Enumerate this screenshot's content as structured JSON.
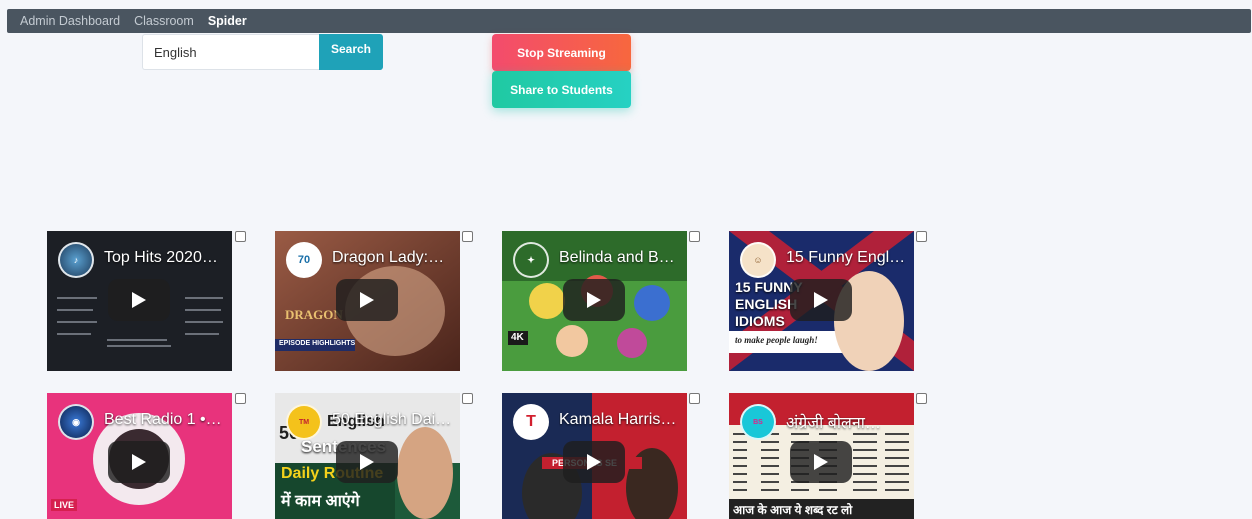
{
  "nav": {
    "items": [
      {
        "label": "Admin Dashboard"
      },
      {
        "label": "Classroom"
      },
      {
        "label": "Spider"
      }
    ]
  },
  "search": {
    "value": "English",
    "button_label": "Search"
  },
  "actions": {
    "stop_label": "Stop Streaming",
    "share_label": "Share to Students"
  },
  "videos": [
    {
      "title": "Top Hits 2020…",
      "icon": "music-channel-icon",
      "colors": {
        "bg": "#1c1f25",
        "accent": "#2a6f9e"
      }
    },
    {
      "title": "Dragon Lady:…",
      "icon": "channel-70-logo-icon",
      "colors": {
        "bg": "#6b3b2e",
        "accent": "#e5c4a0"
      }
    },
    {
      "title": "Belinda and B…",
      "icon": "fairy-tale-channel-icon",
      "colors": {
        "bg": "#3f8f3a",
        "accent": "#f0d04a"
      }
    },
    {
      "title": "15 Funny Engl…",
      "icon": "teacher-avatar-icon",
      "colors": {
        "bg": "#b0213a",
        "accent": "#1a2b6b"
      }
    },
    {
      "title": "Best Radio 1 •…",
      "icon": "radio-channel-icon",
      "colors": {
        "bg": "#e8337c",
        "accent": "#ffffff"
      }
    },
    {
      "title": "50 English Dai…",
      "icon": "tamadaan-logo-icon",
      "colors": {
        "bg": "#1d5a3a",
        "accent": "#f4d21b"
      }
    },
    {
      "title": "Kamala Harris…",
      "icon": "telemundo-logo-icon",
      "colors": {
        "bg": "#1a2a55",
        "accent": "#c3202f"
      }
    },
    {
      "title": "अंग्रेजी बोलना…",
      "icon": "english-channel-icon",
      "colors": {
        "bg": "#f4efe2",
        "accent": "#222222"
      }
    }
  ],
  "thumb_text": {
    "v2_badge": "DRAGON",
    "v2_strip": "EPISODE HIGHLIGHTS",
    "v3_badge": "4K",
    "v4_big": "15 FUNNY ENGLISH IDIOMS",
    "v4_sub": "to make people laugh!",
    "v5_live": "LIVE",
    "v6_num": "50",
    "v6_line1": "English",
    "v6_line2": "Sentences",
    "v6_line3": "Daily Routine",
    "v6_line4": "में काम आएंगे",
    "v7_badge": "PERSONAS SE",
    "v8_bottom": "आज के आज ये शब्द रट लो"
  }
}
